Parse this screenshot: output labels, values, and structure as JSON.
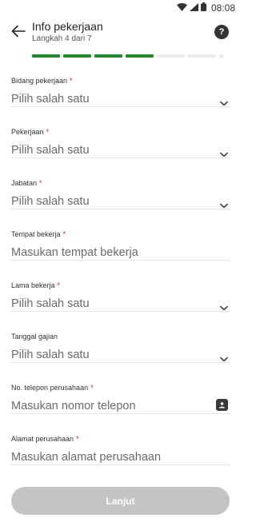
{
  "status_bar": {
    "time": "08:08"
  },
  "header": {
    "title": "Info pekerjaan",
    "subtitle": "Langkah 4 dari 7",
    "help_symbol": "?"
  },
  "progress": {
    "current_step": 4,
    "total_steps": 7,
    "fill_color": "#1f8a2c",
    "empty_color": "#ececec"
  },
  "form": {
    "fields": [
      {
        "label": "Bidang pekerjaan",
        "required": "*",
        "value": "Pilih salah satu",
        "control": "dropdown"
      },
      {
        "label": "Pekerjaan",
        "required": "*",
        "value": "Pilih salah satu",
        "control": "dropdown"
      },
      {
        "label": "Jabatan",
        "required": "*",
        "value": "Pilih salah satu",
        "control": "dropdown"
      },
      {
        "label": "Tempat bekerja",
        "required": "*",
        "value": "Masukan tempat bekerja",
        "control": "text"
      },
      {
        "label": "Lama bekerja",
        "required": "*",
        "value": "Pilih salah satu",
        "control": "dropdown"
      },
      {
        "label": "Tanggal gajian",
        "required": "",
        "value": "Pilih salah satu",
        "control": "dropdown"
      },
      {
        "label": "No. telepon perusahaan",
        "required": "*",
        "value": "Masukan nomor telepon",
        "control": "phone"
      },
      {
        "label": "Alamat perusahaan",
        "required": "*",
        "value": "Masukan alamat perusahaan",
        "control": "text"
      }
    ]
  },
  "submit": {
    "label": "Lanjut",
    "enabled": false,
    "color": "#c4c4c4"
  },
  "icons": {
    "back": "arrow-left-icon",
    "help": "question-icon",
    "dropdown": "chevron-down-icon",
    "contact": "contact-book-icon",
    "wifi": "wifi-icon",
    "signal": "signal-icon",
    "battery": "battery-icon"
  }
}
